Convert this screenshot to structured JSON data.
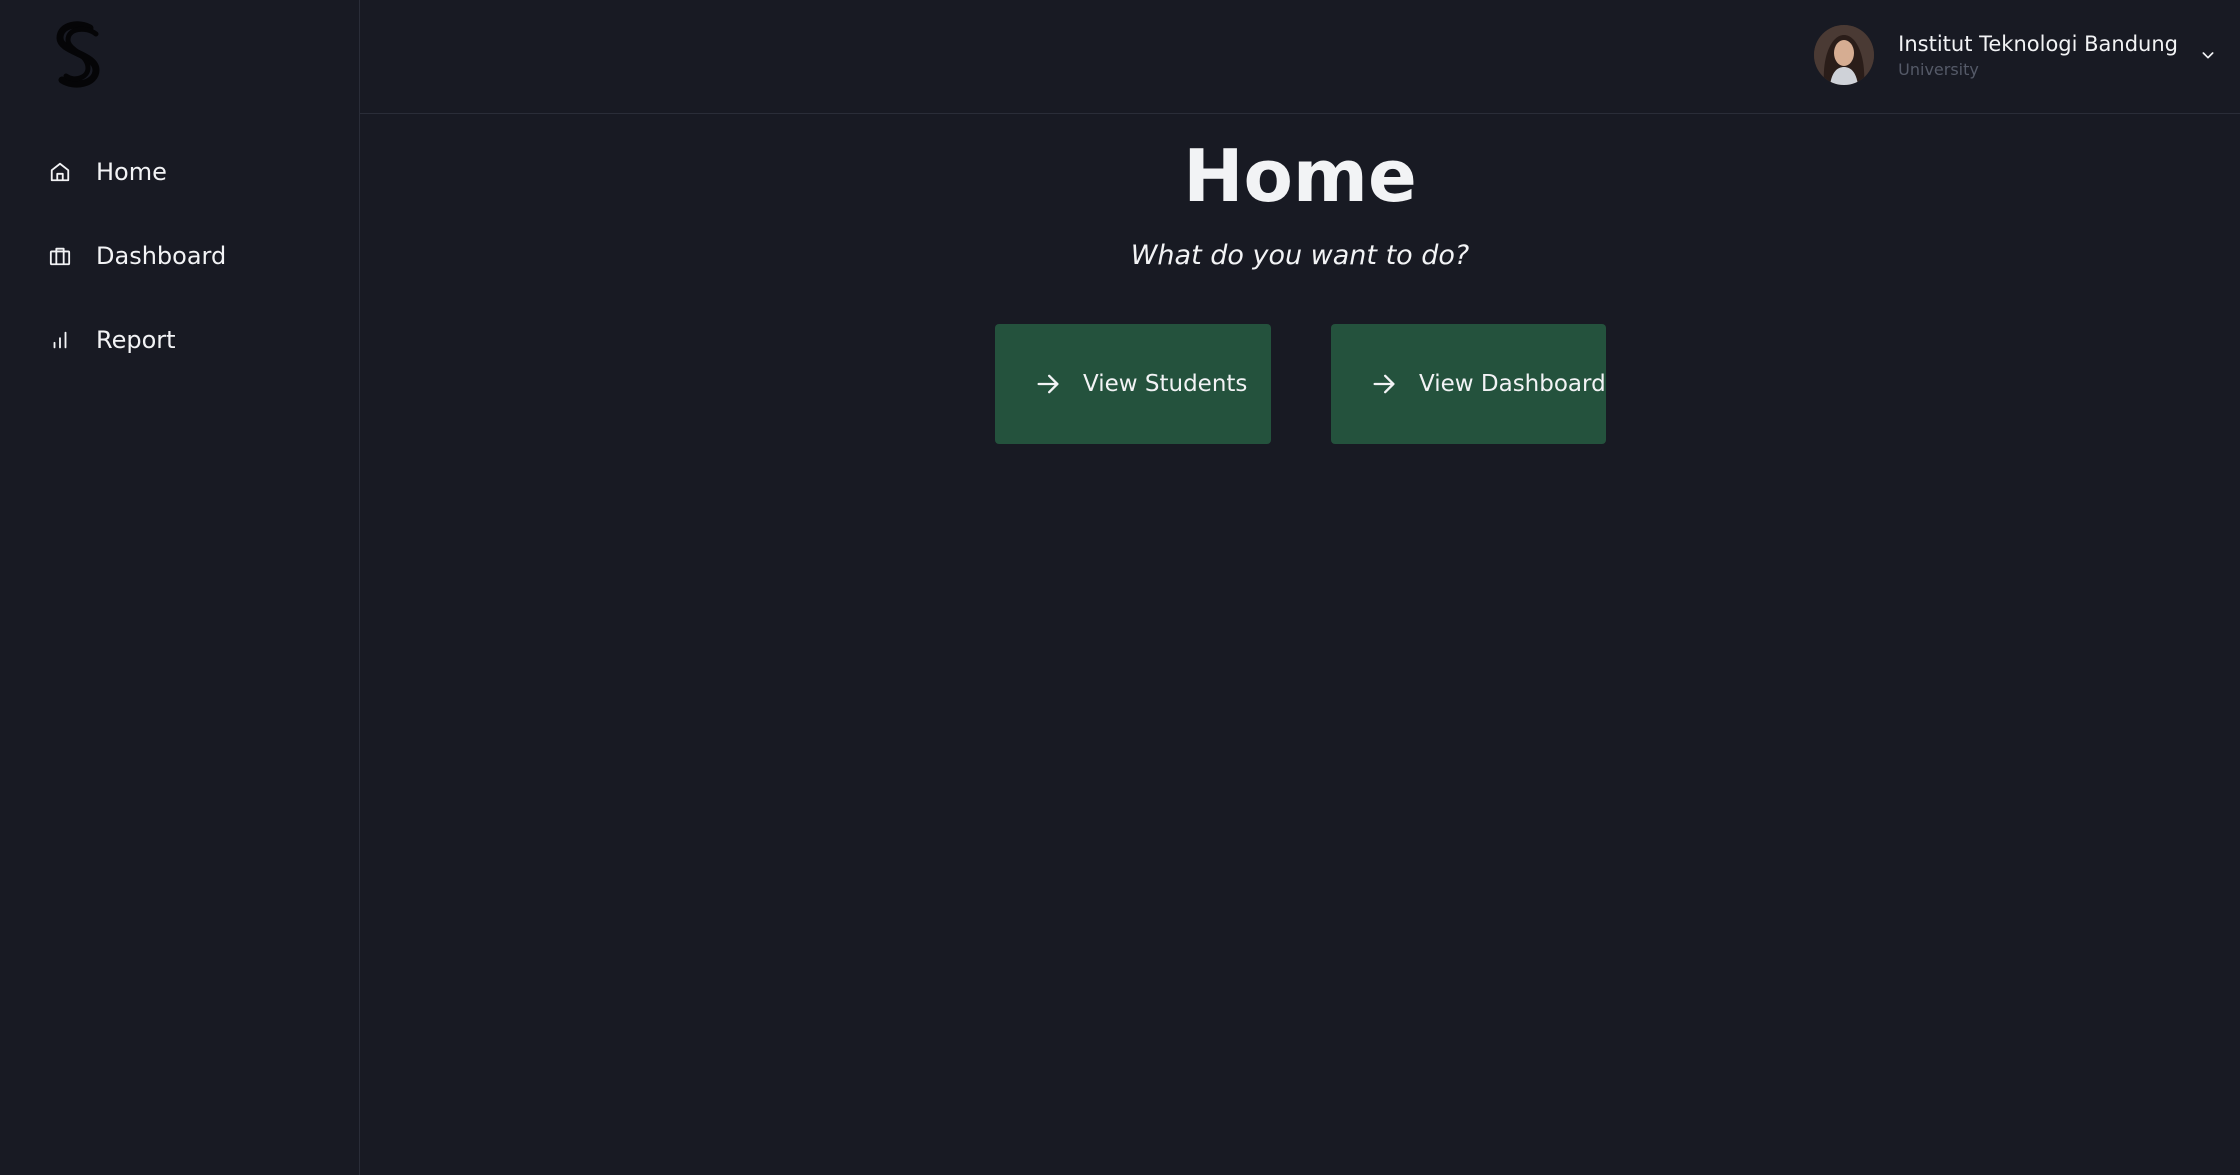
{
  "sidebar": {
    "logo_icon": "brand-s-logo",
    "items": [
      {
        "label": "Home",
        "icon": "home-icon"
      },
      {
        "label": "Dashboard",
        "icon": "briefcase-icon"
      },
      {
        "label": "Report",
        "icon": "bar-chart-icon"
      }
    ]
  },
  "header": {
    "account": {
      "name": "Institut Teknologi Bandung",
      "role": "University",
      "menu_icon": "chevron-down-icon"
    }
  },
  "main": {
    "title": "Home",
    "subtitle": "What do you want to do?",
    "actions": [
      {
        "label": "View Students",
        "icon": "arrow-right-icon"
      },
      {
        "label": "View Dashboard",
        "icon": "arrow-right-icon"
      }
    ]
  },
  "colors": {
    "background": "#181a23",
    "border": "#2a2d38",
    "button": "#24523d",
    "text": "#f2f3f5",
    "muted_text": "#555a68"
  }
}
